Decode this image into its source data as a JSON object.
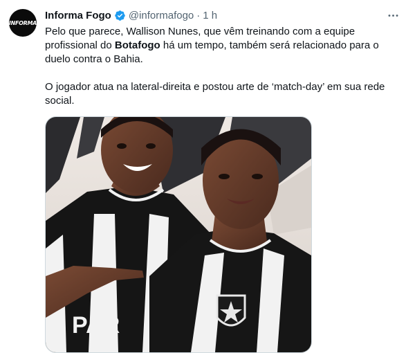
{
  "tweet": {
    "author_name": "Informa Fogo",
    "avatar_text": "INFORMA",
    "handle": "@informafogo",
    "separator": "·",
    "time": "1 h",
    "body": {
      "p1_a": "Pelo que parece, Wallison Nunes, que vêm treinando com a equipe profissional do ",
      "p1_bold": "Botafogo",
      "p1_b": " há um tempo, também será relacionado para o duelo contra o Bahia.",
      "p2": "O jogador atua na lateral-direita e postou arte de ‘match-day’ em sua rede social."
    },
    "media": {
      "jersey_text": "PAR"
    }
  },
  "colors": {
    "verified": "#1d9bf0",
    "secondary_text": "#536471",
    "border": "#cfd9de"
  },
  "icons": [
    "verified-badge-icon",
    "more-options-icon"
  ]
}
